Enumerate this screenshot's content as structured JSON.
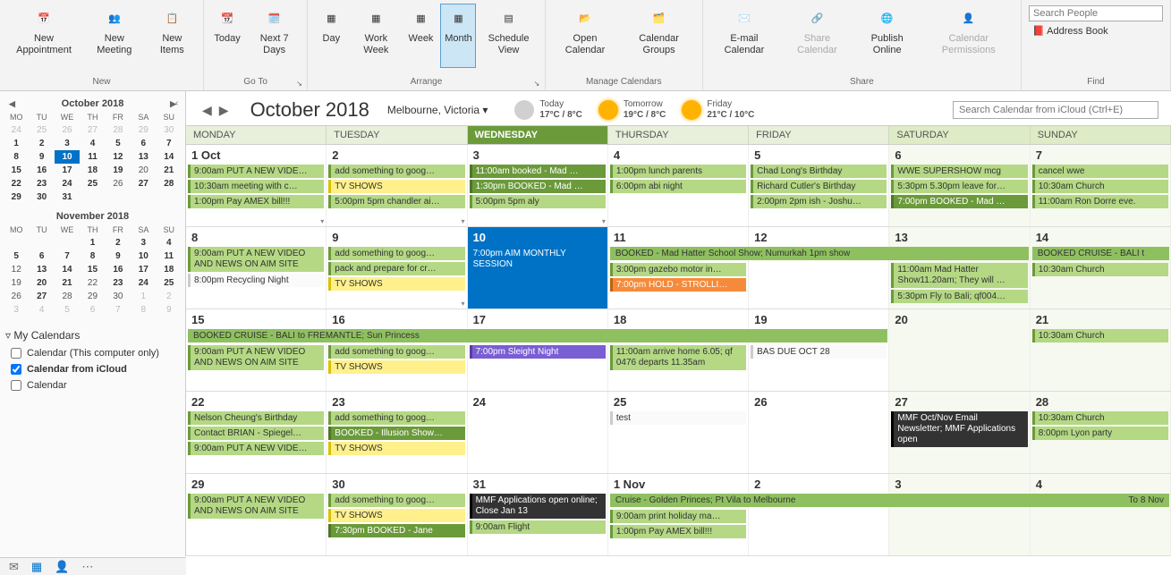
{
  "ribbon": {
    "new": {
      "label": "New",
      "appt": "New Appointment",
      "meeting": "New Meeting",
      "items": "New Items"
    },
    "goto": {
      "label": "Go To",
      "today": "Today",
      "next7": "Next 7 Days"
    },
    "arrange": {
      "label": "Arrange",
      "day": "Day",
      "workweek": "Work Week",
      "week": "Week",
      "month": "Month",
      "schedule": "Schedule View"
    },
    "manage": {
      "label": "Manage Calendars",
      "open": "Open Calendar",
      "groups": "Calendar Groups"
    },
    "share": {
      "label": "Share",
      "email": "E-mail Calendar",
      "share": "Share Calendar",
      "publish": "Publish Online",
      "perms": "Calendar Permissions"
    },
    "find": {
      "label": "Find",
      "search_ph": "Search People",
      "address": "Address Book"
    }
  },
  "sidebar": {
    "oct_title": "October 2018",
    "nov_title": "November 2018",
    "dow": [
      "MO",
      "TU",
      "WE",
      "TH",
      "FR",
      "SA",
      "SU"
    ],
    "oct_grid": [
      [
        {
          "d": "24",
          "c": "om"
        },
        {
          "d": "25",
          "c": "om"
        },
        {
          "d": "26",
          "c": "om"
        },
        {
          "d": "27",
          "c": "om"
        },
        {
          "d": "28",
          "c": "om"
        },
        {
          "d": "29",
          "c": "om"
        },
        {
          "d": "30",
          "c": "om"
        }
      ],
      [
        {
          "d": "1",
          "c": "bold"
        },
        {
          "d": "2",
          "c": "bold"
        },
        {
          "d": "3",
          "c": "bold"
        },
        {
          "d": "4",
          "c": "bold"
        },
        {
          "d": "5",
          "c": "bold"
        },
        {
          "d": "6",
          "c": "bold"
        },
        {
          "d": "7",
          "c": "bold"
        }
      ],
      [
        {
          "d": "8",
          "c": "bold"
        },
        {
          "d": "9",
          "c": "bold"
        },
        {
          "d": "10",
          "c": "today"
        },
        {
          "d": "11",
          "c": "bold"
        },
        {
          "d": "12",
          "c": "bold"
        },
        {
          "d": "13",
          "c": "bold"
        },
        {
          "d": "14",
          "c": "bold"
        }
      ],
      [
        {
          "d": "15",
          "c": "bold"
        },
        {
          "d": "16",
          "c": "bold"
        },
        {
          "d": "17",
          "c": "bold"
        },
        {
          "d": "18",
          "c": "bold"
        },
        {
          "d": "19",
          "c": "bold"
        },
        {
          "d": "20",
          "c": ""
        },
        {
          "d": "21",
          "c": "bold"
        }
      ],
      [
        {
          "d": "22",
          "c": "bold"
        },
        {
          "d": "23",
          "c": "bold"
        },
        {
          "d": "24",
          "c": "bold"
        },
        {
          "d": "25",
          "c": "bold"
        },
        {
          "d": "26",
          "c": ""
        },
        {
          "d": "27",
          "c": "bold"
        },
        {
          "d": "28",
          "c": "bold"
        }
      ],
      [
        {
          "d": "29",
          "c": "bold"
        },
        {
          "d": "30",
          "c": "bold"
        },
        {
          "d": "31",
          "c": "bold"
        },
        {
          "d": "",
          "c": ""
        },
        {
          "d": "",
          "c": ""
        },
        {
          "d": "",
          "c": ""
        },
        {
          "d": "",
          "c": ""
        }
      ]
    ],
    "nov_grid": [
      [
        {
          "d": "",
          "c": ""
        },
        {
          "d": "",
          "c": ""
        },
        {
          "d": "",
          "c": ""
        },
        {
          "d": "1",
          "c": "bold"
        },
        {
          "d": "2",
          "c": "bold"
        },
        {
          "d": "3",
          "c": "bold"
        },
        {
          "d": "4",
          "c": "bold"
        }
      ],
      [
        {
          "d": "5",
          "c": "bold"
        },
        {
          "d": "6",
          "c": "bold"
        },
        {
          "d": "7",
          "c": "bold"
        },
        {
          "d": "8",
          "c": "bold"
        },
        {
          "d": "9",
          "c": "bold"
        },
        {
          "d": "10",
          "c": "bold"
        },
        {
          "d": "11",
          "c": "bold"
        }
      ],
      [
        {
          "d": "12",
          "c": ""
        },
        {
          "d": "13",
          "c": "bold"
        },
        {
          "d": "14",
          "c": "bold"
        },
        {
          "d": "15",
          "c": "bold"
        },
        {
          "d": "16",
          "c": "bold"
        },
        {
          "d": "17",
          "c": "bold"
        },
        {
          "d": "18",
          "c": "bold"
        }
      ],
      [
        {
          "d": "19",
          "c": ""
        },
        {
          "d": "20",
          "c": "bold"
        },
        {
          "d": "21",
          "c": "bold"
        },
        {
          "d": "22",
          "c": ""
        },
        {
          "d": "23",
          "c": "bold"
        },
        {
          "d": "24",
          "c": "bold"
        },
        {
          "d": "25",
          "c": "bold"
        }
      ],
      [
        {
          "d": "26",
          "c": ""
        },
        {
          "d": "27",
          "c": "bold"
        },
        {
          "d": "28",
          "c": ""
        },
        {
          "d": "29",
          "c": ""
        },
        {
          "d": "30",
          "c": ""
        },
        {
          "d": "1",
          "c": "om"
        },
        {
          "d": "2",
          "c": "om"
        }
      ],
      [
        {
          "d": "3",
          "c": "om"
        },
        {
          "d": "4",
          "c": "om"
        },
        {
          "d": "5",
          "c": "om"
        },
        {
          "d": "6",
          "c": "om"
        },
        {
          "d": "7",
          "c": "om"
        },
        {
          "d": "8",
          "c": "om"
        },
        {
          "d": "9",
          "c": "om"
        }
      ]
    ],
    "my_cal_heading": "My Calendars",
    "cal_items": [
      {
        "label": "Calendar (This computer only)",
        "checked": false
      },
      {
        "label": "Calendar from iCloud",
        "checked": true,
        "bold": true
      },
      {
        "label": "Calendar",
        "checked": false
      }
    ]
  },
  "header": {
    "title": "October 2018",
    "location": "Melbourne, Victoria",
    "weather": [
      {
        "label": "Today",
        "temp": "17°C / 8°C",
        "cloud": true
      },
      {
        "label": "Tomorrow",
        "temp": "19°C / 8°C",
        "cloud": false
      },
      {
        "label": "Friday",
        "temp": "21°C / 10°C",
        "cloud": false
      }
    ],
    "search_ph": "Search Calendar from iCloud (Ctrl+E)"
  },
  "dayheads": [
    "MONDAY",
    "TUESDAY",
    "WEDNESDAY",
    "THURSDAY",
    "FRIDAY",
    "SATURDAY",
    "SUNDAY"
  ],
  "today_col": 2,
  "weeks": [
    {
      "days": [
        {
          "n": "1 Oct",
          "ev": [
            {
              "t": "9:00am PUT A NEW VIDE…",
              "c": "lg"
            },
            {
              "t": "10:30am meeting with c…",
              "c": "lg"
            },
            {
              "t": "1:00pm Pay AMEX bill!!!",
              "c": "lg"
            }
          ],
          "more": true
        },
        {
          "n": "2",
          "ev": [
            {
              "t": "add something to goog…",
              "c": "lg"
            },
            {
              "t": "TV SHOWS",
              "c": "yl"
            },
            {
              "t": "5:00pm 5pm chandler ai…",
              "c": "lg"
            }
          ],
          "more": true
        },
        {
          "n": "3",
          "today": true,
          "ev": [
            {
              "t": "11:00am booked - Mad …",
              "c": "dg"
            },
            {
              "t": "1:30pm BOOKED - Mad …",
              "c": "dg"
            },
            {
              "t": "5:00pm 5pm aly",
              "c": "lg"
            }
          ],
          "more": true
        },
        {
          "n": "4",
          "ev": [
            {
              "t": "1:00pm lunch parents",
              "c": "lg"
            },
            {
              "t": "6:00pm abi night",
              "c": "lg"
            }
          ]
        },
        {
          "n": "5",
          "ev": [
            {
              "t": "Chad Long's Birthday",
              "c": "lg"
            },
            {
              "t": "Richard Cutler's Birthday",
              "c": "lg"
            },
            {
              "t": "2:00pm 2pm ish - Joshu…",
              "c": "lg"
            }
          ]
        },
        {
          "n": "6",
          "we": true,
          "ev": [
            {
              "t": "WWE SUPERSHOW mcg",
              "c": "lg"
            },
            {
              "t": "5:30pm 5.30pm leave for…",
              "c": "lg"
            },
            {
              "t": "7:00pm BOOKED - Mad …",
              "c": "dg"
            }
          ]
        },
        {
          "n": "7",
          "we": true,
          "ev": [
            {
              "t": "cancel wwe",
              "c": "lg"
            },
            {
              "t": "10:30am Church",
              "c": "lg"
            },
            {
              "t": "11:00am  Ron Dorre eve.",
              "c": "lg"
            }
          ]
        }
      ]
    },
    {
      "days": [
        {
          "n": "8",
          "ev": [
            {
              "t": "9:00am PUT A NEW VIDEO AND NEWS ON AIM SITE",
              "c": "lg",
              "tall": true
            },
            {
              "t": "8:00pm Recycling Night",
              "c": "wh"
            }
          ]
        },
        {
          "n": "9",
          "ev": [
            {
              "t": "add something to goog…",
              "c": "lg"
            },
            {
              "t": "pack and prepare for cr…",
              "c": "lg"
            },
            {
              "t": "TV SHOWS",
              "c": "yl"
            }
          ],
          "more": true
        },
        {
          "n": "10",
          "today": true,
          "ev": [
            {
              "t": "7:00pm AIM MONTHLY SESSION",
              "c": "",
              "tall": true
            }
          ],
          "todaycell": true
        },
        {
          "n": "11",
          "span_start": true
        },
        {
          "n": "12"
        },
        {
          "n": "13",
          "we": true,
          "ev": [
            {
              "t": "11:00am Mad Hatter Show11.20am; They will …",
              "c": "lg",
              "tall": true
            },
            {
              "t": "5:30pm Fly to Bali; qf004…",
              "c": "lg"
            }
          ]
        },
        {
          "n": "14",
          "we": true,
          "span2": true
        }
      ],
      "spans": [
        {
          "start": 3,
          "end": 5,
          "text": "BOOKED - Mad Hatter School Show; Numurkah 1pm show",
          "c": "sp"
        },
        {
          "start": 6,
          "end": 7,
          "text": "BOOKED CRUISE - BALI t",
          "c": "sp"
        }
      ],
      "extra": {
        "3": [
          {
            "t": "3:00pm gazebo motor in…",
            "c": "lg"
          },
          {
            "t": "7:00pm HOLD - STROLLI…",
            "c": "or"
          }
        ],
        "6": [
          {
            "t": "10:30am Church",
            "c": "lg"
          }
        ]
      }
    },
    {
      "days": [
        {
          "n": "15"
        },
        {
          "n": "16"
        },
        {
          "n": "17"
        },
        {
          "n": "18"
        },
        {
          "n": "19",
          "ev2": [
            {
              "t": "BAS DUE OCT 28",
              "c": "wh"
            }
          ]
        },
        {
          "n": "20",
          "we": true
        },
        {
          "n": "21",
          "we": true,
          "ev2": [
            {
              "t": "10:30am Church",
              "c": "lg"
            }
          ]
        }
      ],
      "spans": [
        {
          "start": 0,
          "end": 4,
          "text": "BOOKED CRUISE - BALI to FREMANTLE; Sun Princess",
          "c": "sp",
          "bold": true
        }
      ],
      "after": {
        "0": [
          {
            "t": "9:00am PUT A NEW VIDEO AND NEWS ON AIM SITE",
            "c": "lg",
            "tall": true
          }
        ],
        "1": [
          {
            "t": "add something to goog…",
            "c": "lg"
          },
          {
            "t": "TV SHOWS",
            "c": "yl"
          }
        ],
        "2": [
          {
            "t": "7:00pm Sleight Night",
            "c": "pu"
          }
        ],
        "3": [
          {
            "t": "11:00am arrive home 6.05; qf 0476 departs 11.35am",
            "c": "lg",
            "tall": true
          }
        ]
      }
    },
    {
      "days": [
        {
          "n": "22",
          "ev": [
            {
              "t": "Nelson Cheung's Birthday",
              "c": "lg"
            },
            {
              "t": "Contact BRIAN - Spiegel…",
              "c": "lg"
            },
            {
              "t": "9:00am PUT A NEW VIDE…",
              "c": "lg"
            }
          ]
        },
        {
          "n": "23",
          "ev": [
            {
              "t": "add something to goog…",
              "c": "lg"
            },
            {
              "t": "BOOKED - Illusion Show…",
              "c": "dg"
            },
            {
              "t": "TV SHOWS",
              "c": "yl"
            }
          ]
        },
        {
          "n": "24"
        },
        {
          "n": "25",
          "ev": [
            {
              "t": "test",
              "c": "wh"
            }
          ]
        },
        {
          "n": "26"
        },
        {
          "n": "27",
          "we": true,
          "ev": [
            {
              "t": "MMF Oct/Nov Email Newsletter; MMF Applications open",
              "c": "bk",
              "tall": true
            }
          ]
        },
        {
          "n": "28",
          "we": true,
          "ev": [
            {
              "t": "10:30am Church",
              "c": "lg"
            },
            {
              "t": "8:00pm Lyon party",
              "c": "lg"
            }
          ]
        }
      ]
    },
    {
      "days": [
        {
          "n": "29",
          "ev": [
            {
              "t": "9:00am PUT A NEW VIDEO AND NEWS ON AIM SITE",
              "c": "lg",
              "tall": true
            }
          ]
        },
        {
          "n": "30",
          "ev": [
            {
              "t": "add something to goog…",
              "c": "lg"
            },
            {
              "t": "TV SHOWS",
              "c": "yl"
            },
            {
              "t": "7:30pm BOOKED - Jane",
              "c": "dg"
            }
          ]
        },
        {
          "n": "31",
          "ev": [
            {
              "t": "MMF Applications open online; Close Jan 13",
              "c": "bk",
              "tall": true
            },
            {
              "t": "9:00am Flight",
              "c": "lg"
            }
          ]
        },
        {
          "n": "1 Nov"
        },
        {
          "n": "2"
        },
        {
          "n": "3",
          "we": true
        },
        {
          "n": "4",
          "we": true
        }
      ],
      "spans": [
        {
          "start": 3,
          "end": 7,
          "text": "Cruise - Golden Princes; Pt Vila to Melbourne",
          "right": "To 8 Nov",
          "c": "sp"
        }
      ],
      "after": {
        "3": [
          {
            "t": "9:00am print holiday ma…",
            "c": "lg"
          },
          {
            "t": "1:00pm Pay AMEX bill!!!",
            "c": "lg"
          }
        ]
      }
    }
  ]
}
